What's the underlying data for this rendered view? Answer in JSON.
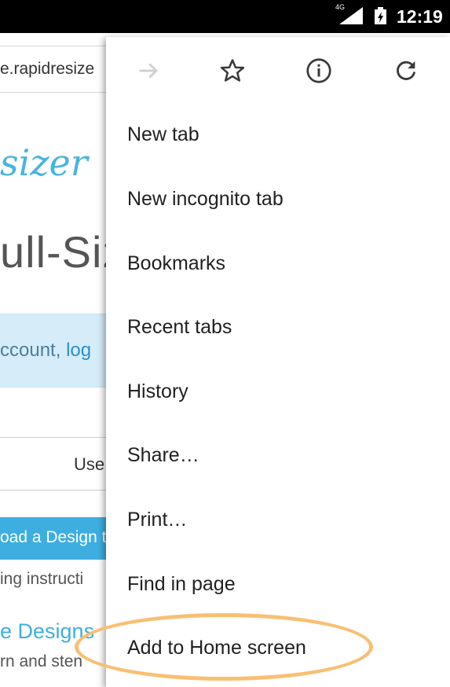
{
  "status_bar": {
    "network_label": "4G",
    "time": "12:19"
  },
  "background_page": {
    "url_fragment": "e.rapidresize",
    "logo_fragment": "sizer",
    "hero_title_fragment": "ull-Siz",
    "notice_text_fragment": "ccount,",
    "notice_link_fragment": "log",
    "tab_label_fragment": "Use",
    "upload_button_fragment": "oad a Design t",
    "instructions_fragment": "ing instructi",
    "designs_heading_fragment": "e Designs",
    "pattern_fragment": "rn and sten"
  },
  "menu": {
    "icons": [
      "forward-icon",
      "star-icon",
      "info-icon",
      "refresh-icon"
    ],
    "items": [
      {
        "label": "New tab"
      },
      {
        "label": "New incognito tab"
      },
      {
        "label": "Bookmarks"
      },
      {
        "label": "Recent tabs"
      },
      {
        "label": "History"
      },
      {
        "label": "Share…"
      },
      {
        "label": "Print…"
      },
      {
        "label": "Find in page"
      },
      {
        "label": "Add to Home screen"
      }
    ],
    "highlighted_item": "Add to Home screen",
    "highlight_color": "#f8bf73"
  },
  "colors": {
    "accent": "#3eaee0",
    "menu_text": "#212121",
    "status_bar": "#000000"
  }
}
